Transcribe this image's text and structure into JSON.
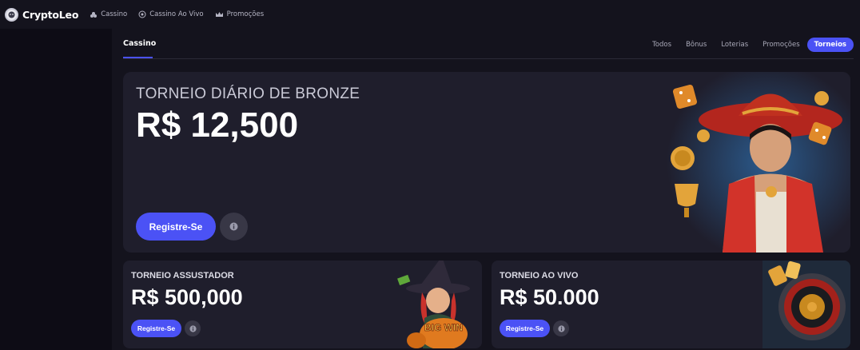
{
  "brand": {
    "name": "CryptoLeo"
  },
  "topnav": [
    {
      "label": "Cassino",
      "icon": "cards-icon"
    },
    {
      "label": "Cassino Ao Vivo",
      "icon": "live-casino-icon"
    },
    {
      "label": "Promoções",
      "icon": "crown-icon"
    }
  ],
  "tabs": {
    "active": "Cassino"
  },
  "filters": [
    {
      "label": "Todos",
      "active": false
    },
    {
      "label": "Bônus",
      "active": false
    },
    {
      "label": "Loterias",
      "active": false
    },
    {
      "label": "Promoções",
      "active": false
    },
    {
      "label": "Torneios",
      "active": true
    }
  ],
  "hero": {
    "title": "TORNEIO DIÁRIO DE BRONZE",
    "amount": "R$ 12,500",
    "register_label": "Registre-Se",
    "info_label": "i"
  },
  "cards": [
    {
      "title": "TORNEIO ASSUSTADOR",
      "amount": "R$ 500,000",
      "register_label": "Registre-Se",
      "info_label": "i"
    },
    {
      "title": "TORNEIO AO VIVO",
      "amount": "R$ 50.000",
      "register_label": "Registre-Se",
      "info_label": "i"
    }
  ],
  "artwork": {
    "hero_text": "",
    "card1_text": "BIG WIN"
  },
  "colors": {
    "accent": "#4b52f5",
    "background": "#14131d",
    "card": "#1f1e2c",
    "sidebar": "#0d0c15"
  }
}
